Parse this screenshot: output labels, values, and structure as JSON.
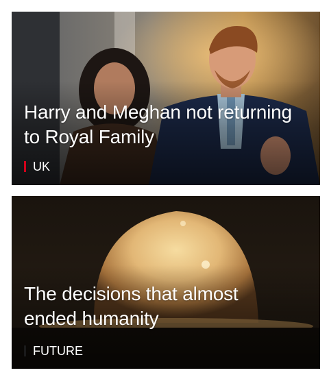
{
  "colors": {
    "uk_accent": "#d0021b",
    "future_accent": "#1a1a1a",
    "text": "#ffffff"
  },
  "cards": [
    {
      "headline": "Harry and Meghan not returning to Royal Family",
      "section": "UK",
      "image": "royal-couple-photo"
    },
    {
      "headline": "The decisions that almost ended humanity",
      "section": "FUTURE",
      "image": "nuclear-fireball-photo"
    }
  ]
}
